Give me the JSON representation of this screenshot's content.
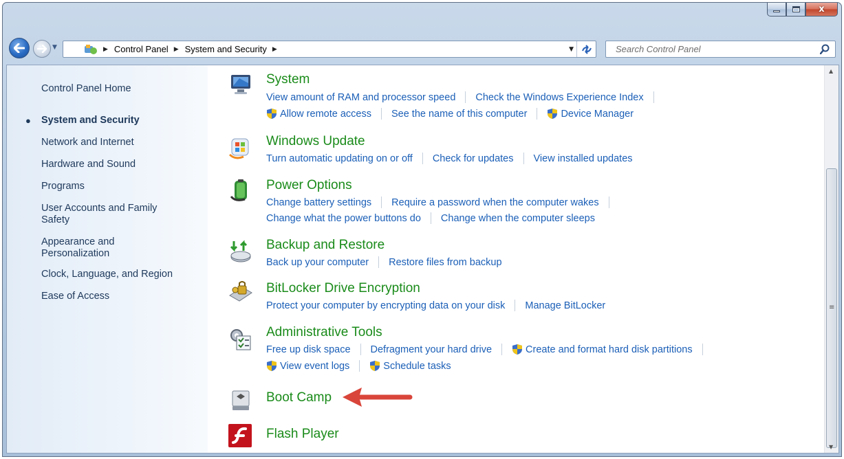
{
  "window": {
    "caption_buttons": {
      "minimize_icon": "minimize-icon",
      "maximize_icon": "maximize-icon",
      "close_glyph": "x"
    }
  },
  "address": {
    "crumbs": [
      "Control Panel",
      "System and Security"
    ],
    "search_placeholder": "Search Control Panel"
  },
  "sidebar": {
    "home": "Control Panel Home",
    "items": [
      {
        "label": "System and Security",
        "active": true
      },
      {
        "label": "Network and Internet"
      },
      {
        "label": "Hardware and Sound"
      },
      {
        "label": "Programs"
      },
      {
        "label": "User Accounts and Family Safety"
      },
      {
        "label": "Appearance and Personalization"
      },
      {
        "label": "Clock, Language, and Region"
      },
      {
        "label": "Ease of Access"
      }
    ]
  },
  "categories": [
    {
      "title": "System",
      "icon": "computer-icon",
      "rows": [
        [
          {
            "label": "View amount of RAM and processor speed"
          },
          {
            "label": "Check the Windows Experience Index"
          }
        ],
        [
          {
            "label": "Allow remote access",
            "shield": true
          },
          {
            "label": "See the name of this computer"
          },
          {
            "label": "Device Manager",
            "shield": true
          }
        ]
      ]
    },
    {
      "title": "Windows Update",
      "icon": "windows-update-icon",
      "rows": [
        [
          {
            "label": "Turn automatic updating on or off"
          },
          {
            "label": "Check for updates"
          },
          {
            "label": "View installed updates"
          }
        ]
      ]
    },
    {
      "title": "Power Options",
      "icon": "battery-icon",
      "rows": [
        [
          {
            "label": "Change battery settings"
          },
          {
            "label": "Require a password when the computer wakes"
          }
        ],
        [
          {
            "label": "Change what the power buttons do"
          },
          {
            "label": "Change when the computer sleeps"
          }
        ]
      ]
    },
    {
      "title": "Backup and Restore",
      "icon": "backup-icon",
      "rows": [
        [
          {
            "label": "Back up your computer"
          },
          {
            "label": "Restore files from backup"
          }
        ]
      ]
    },
    {
      "title": "BitLocker Drive Encryption",
      "icon": "bitlocker-icon",
      "rows": [
        [
          {
            "label": "Protect your computer by encrypting data on your disk"
          },
          {
            "label": "Manage BitLocker"
          }
        ]
      ]
    },
    {
      "title": "Administrative Tools",
      "icon": "admin-tools-icon",
      "rows": [
        [
          {
            "label": "Free up disk space"
          },
          {
            "label": "Defragment your hard drive"
          },
          {
            "label": "Create and format hard disk partitions",
            "shield": true
          }
        ],
        [
          {
            "label": "View event logs",
            "shield": true
          },
          {
            "label": "Schedule tasks",
            "shield": true
          }
        ]
      ]
    },
    {
      "title": "Boot Camp",
      "icon": "boot-camp-icon",
      "rows": []
    },
    {
      "title": "Flash Player",
      "icon": "flash-player-icon",
      "rows": []
    }
  ],
  "annotation": {
    "type": "red-arrow",
    "points_to": "Boot Camp"
  },
  "colors": {
    "link": "#1b5fb7",
    "category_title": "#1a8b1a",
    "annotation_arrow": "#d9453a"
  }
}
